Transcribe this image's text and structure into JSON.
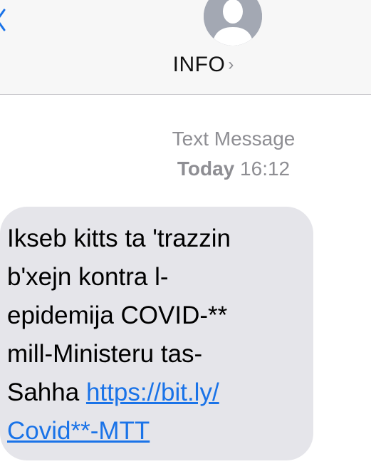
{
  "header": {
    "contact_name": "INFO",
    "contact_chevron": "›",
    "avatar_icon": "person-silhouette-icon",
    "back_icon": "chevron-left-icon",
    "accent_color": "#1a73e8"
  },
  "thread": {
    "service_label": "Text Message",
    "day_label": "Today",
    "time_label": "16:12"
  },
  "message": {
    "text": "Ikseb kitts ta 'trazzin\nb'xejn kontra l-\nepidemija COVID-**\nmill-Ministeru tas-\nSahha ",
    "link_text": "https://bit.ly/\nCovid**-MTT",
    "bubble_color": "#e5e5ea"
  }
}
